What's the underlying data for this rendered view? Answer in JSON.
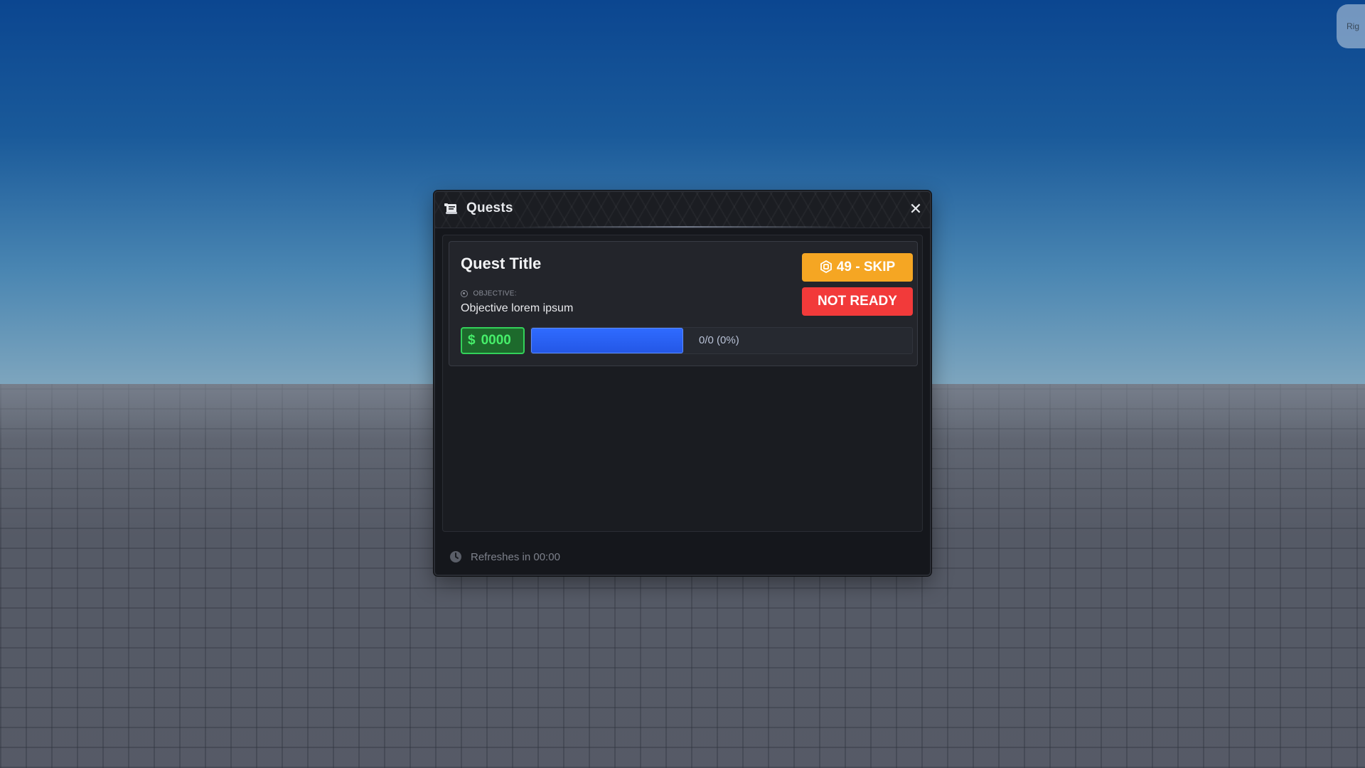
{
  "window": {
    "title": "Quests",
    "close_icon": "close-icon",
    "header_icon": "scroll-icon"
  },
  "corner_badge": {
    "text": "Rig"
  },
  "quest": {
    "title": "Quest Title",
    "objective_label": "OBJECTIVE:",
    "objective_text": "Objective lorem ipsum",
    "skip_label": "49 - SKIP",
    "skip_icon": "robux-icon",
    "status_label": "NOT READY",
    "reward_symbol": "$",
    "reward_amount": "0000",
    "progress_text": "0/0 (0%)",
    "progress_fill_fraction": 0.4
  },
  "footer": {
    "refresh_text": "Refreshes in 00:00",
    "icon": "clock-icon"
  },
  "colors": {
    "skip_button": "#f5a623",
    "not_ready_button": "#f23a3a",
    "reward_green": "#46ef6a",
    "progress_blue": "#2f6bff",
    "panel_bg": "#15171c"
  }
}
